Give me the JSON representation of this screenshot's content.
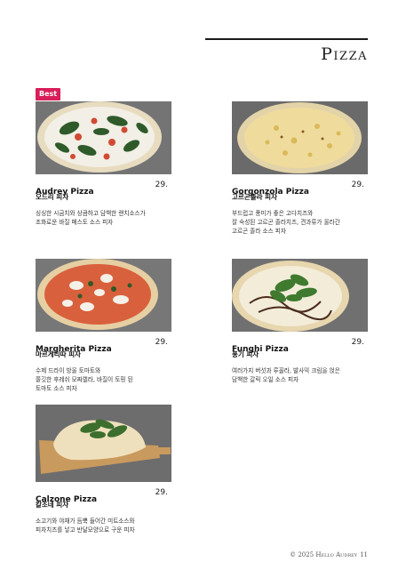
{
  "page": {
    "section_title": "Pizza",
    "best_badge": "Best",
    "footer": {
      "copyright": "© 2025 Hello Audrey",
      "page_number": "11"
    }
  },
  "menu": [
    {
      "name": "Audrey Pizza",
      "name_kr": "오드리 피자",
      "price": "29.",
      "desc": [
        "싱싱한 시금치와 상큼하고 담백한 랜치소스가",
        "조화로운 바질 페스토 소스 피자"
      ]
    },
    {
      "name": "Gorgonzola Pizza",
      "name_kr": "고르곤졸라 피자",
      "price": "29.",
      "desc": [
        "부드럽고 풍미가 좋은 고다치즈와",
        "잘 숙성된 고르곤 졸라치즈, 견과류가 올라간",
        "고르곤 졸라 소스 피자"
      ]
    },
    {
      "name": "Margherita Pizza",
      "name_kr": "마르게리따 피자",
      "price": "29.",
      "desc": [
        "수제 드라이 방울 토마토와",
        "쫄깃한 후레쉬 모짜렐라, 바질이 토핑 된",
        "토마토 소스 피자"
      ]
    },
    {
      "name": "Funghi Pizza",
      "name_kr": "풍기 피자",
      "price": "29.",
      "desc": [
        "여러가지 버섯과 루꼴라, 발사믹 크림을 얹은",
        "담백한 갈릭 오일 소스 피자"
      ]
    },
    {
      "name": "Calzone Pizza",
      "name_kr": "칼조네 피자",
      "price": "29.",
      "desc": [
        "소고기와 야채가 듬뿍 들어간 미트소스와",
        "피자치즈를 넣고 반달모양으로 구운 피자"
      ]
    }
  ]
}
